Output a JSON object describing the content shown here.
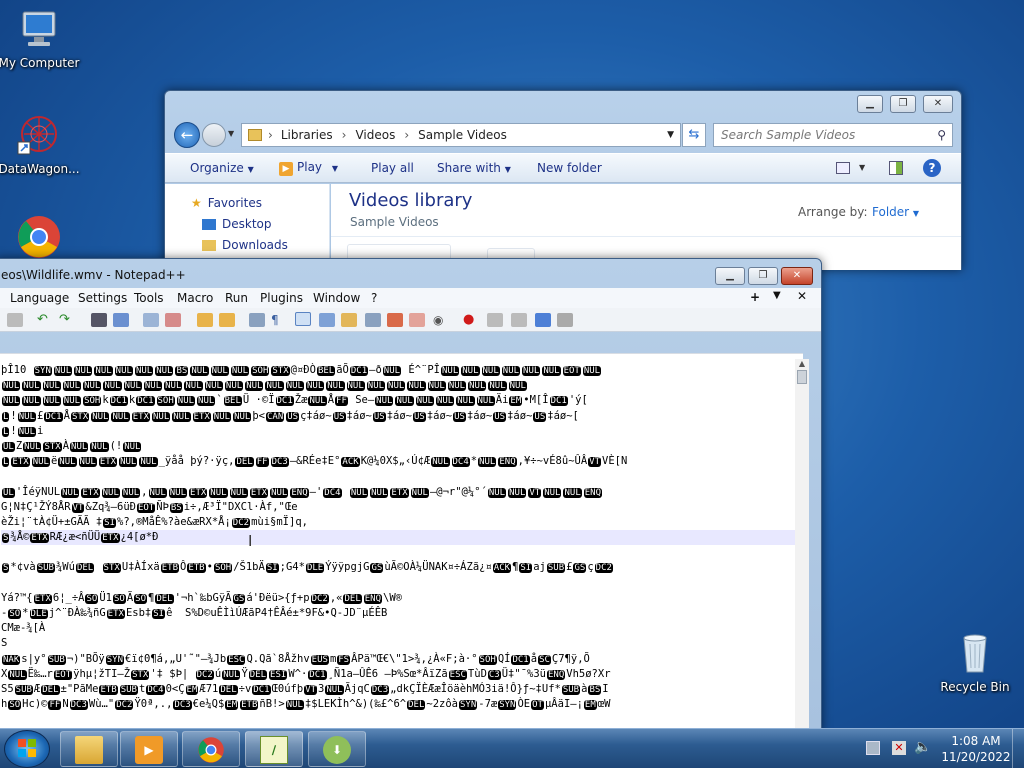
{
  "desktop": {
    "icons": [
      {
        "label": "My Computer",
        "icon": "computer-icon"
      },
      {
        "label": "DataWagon...",
        "icon": "datawagon-icon"
      },
      {
        "label": "",
        "icon": "chrome-icon"
      },
      {
        "label": "Recycle Bin",
        "icon": "recycle-bin-icon"
      }
    ]
  },
  "explorer": {
    "breadcrumb": [
      "Libraries",
      "Videos",
      "Sample Videos"
    ],
    "search_placeholder": "Search Sample Videos",
    "toolbar": {
      "organize": "Organize",
      "play": "Play",
      "play_all": "Play all",
      "share_with": "Share with",
      "new_folder": "New folder"
    },
    "nav": {
      "favorites": "Favorites",
      "items": [
        "Desktop",
        "Downloads"
      ]
    },
    "library_title": "Videos library",
    "library_subtitle": "Sample Videos",
    "arrange_label": "Arrange by:",
    "arrange_value": "Folder"
  },
  "notepad": {
    "title": "eos\\Wildlife.wmv - Notepad++",
    "menu": [
      "Language",
      "Settings",
      "Tools",
      "Macro",
      "Run",
      "Plugins",
      "Window",
      "?"
    ],
    "lines": [
      "þÎ10 [SYN][NUL][NUL][NUL][NUL][NUL][NUL][BS][NUL][NUL][NUL][SOH][STX]@¤ÐÒ[BEL]ãÕ[DC1]—ð[NUL] É^¨PÎ[NUL][NUL][NUL][NUL][NUL][NUL][EOT][NUL]",
      "[NUL][NUL][NUL][NUL][NUL][NUL][NUL][NUL][NUL][NUL][NUL][NUL][NUL][NUL][NUL][NUL][NUL][NUL][NUL][NUL][NUL][NUL][NUL][NUL][NUL][NUL]",
      "[NUL][NUL][NUL][NUL][SOH]k[DC1]k[DC1][SOH][NUL][NUL]`[BEL]Ü ·©Ï[DC1]Žæ[NUL]Å[FF] Se—[NUL][NUL][NUL][NUL][NUL][NUL]Äi[EM]•M[Î[DC1]'ý[",
      "[L]![NUL]£[DC1]Å[STX][NUL][NUL][ETX][NUL][NUL][ETX][NUL][NUL]þ<[CAN][US]ç‡áø~[US]‡áø~[US]‡áø~[US]‡áø~[US]‡áø~[US]‡áø~[US]‡áø~[",
      "[L]![NUL]i",
      "[UL]Z[NUL][STX]À[NUL][NUL](![NUL]",
      "[L][ETX][NUL]ë[NUL][NUL][ETX][NUL][NUL]_ÿåå þý?·ÿç,[DEL][FF][DC3]—&RÉe‡E°[ACK]K@¼0X$„‹Ú¢Æ[NUL][DC4]*[NUL][ENQ],¥÷~vÉ8û~ÛÂ[VT]VÈ[N",
      "",
      "[UL]'ÎéÿNUL[NUL][ETX][NUL][NUL],[NUL][NUL][ETX][NUL][NUL][ETX][NUL][ENQ]—'[DC4] [NUL][NUL][ETX][NUL]—@¬r\"@¼°´[NUL][NUL][VT][NUL][NUL][ENQ]",
      "G¦N‡Ç¹ŽÝ8ÅR[VT]&Zq¾—6üÐ[EOT]ÑÞ[BS]i÷,Æ³Ï\"DXCl·Àf,\"Œe",
      "èŽi¦¨tÀ¢Ü+±GÃÃ ‡[SI]%?,®MåÊ%?àe&æRX*Å¡[DC2]mùi§mÏ]q,",
      "[S]¾Å©[ETX]RÆ¿æ<ñÜÜ[ETX]¿4[ø*Ð",
      "",
      "[S]*¢và[SUB]¾Wú[DEL] [STX]U‡ÀÍxä[ETB]Ô[ETB]•[SOH]/Š1bÄ[SI];G4*[DLE]ÝÿÿpgjG[GS]ùÃ©OÀ¼ÜNAK¤÷ÁZã¿¤[ACK]¶[SI]aj[SUB]£[GS]ç[DC2]",
      "",
      "Yá?™{[ETX]6¦_÷Â[SO]Ü1[SO]Ã[SO]¶[DEL]'¬h`‰bGÿÃ[GS]á'Ðëü>{ƒ+p[DC2],«[DEL][ENQ]\\W®",
      "‐[SO]*[DLE]j^¨ÐÀ‰¾ñG[ETX]Esb‡[SI]ê  S%D©uÊÌìÚÆãP4†ÊÂé±*9F&•Q-JD¨µÉÊB",
      "CMæ-¾[À",
      "S",
      "[NAK]s|y°[SUB]¬)\"BÕÿ[SYN]€ï¢0¶á,„U'˜\"–¾Jb[ESC]Q.Qã`8Åžhv[EUS]m[FS]ÂPä™Œ€\\\"1>¾,¿À«F;à·°[SOH]QÍ[DC1]å[SC]Ç7¶ÿ,Õ",
      "X[NUL]Ë‰…r[EOT]ÿhµ¦žTI—Ž[STX]'‡ $Þ| [DC2]ú[NUL]Ÿ[DEL][ESI]W^·[DC1]¸Ñ1a—ÛÊ6 —Þ%Sœ*ÂïZã[ESC]TùD[C3]Ü‡\"¯%3ü[ENQ]Vh5ø?Xr",
      "S5[SUB]Æ[DEL]±\"PãMe[ETB][SUB]t[DC4]0<Ç[EM]Æ71[DEL]÷v[DC1]Œ0úfþ[VT]3[NUL]ÃjqC[DC3]„dkÇÏÈÆæÎöäèhMÓ3iä!Ô}ƒ~‡Uf*[SUB]à[BS]I",
      "h[SO]Hc)©[FF]N[DC3]Wù…\"[DC2]Ÿ0ª,.,[DC3]€e¼Q$[EM][ETB]ñB!>[NUL]‡$LEKÌh^&)(‰£^6^[DEL]~2zôà[SYN]-7æ[SYN]ÒE[OT]µÂäI–¡[EM]œW"
    ]
  },
  "taskbar": {
    "time": "1:08 AM",
    "date": "11/20/2022",
    "apps": [
      "explorer-icon",
      "media-player-icon",
      "chrome-icon",
      "notepad-plus-plus-icon",
      "install-icon"
    ]
  }
}
